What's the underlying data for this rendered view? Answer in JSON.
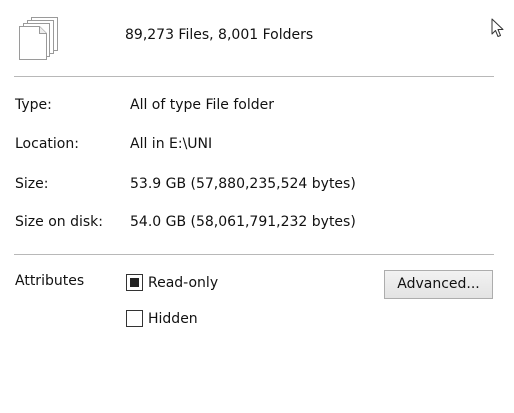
{
  "header": {
    "icon": "stacked-documents-icon",
    "summary": "89,273 Files, 8,001 Folders"
  },
  "properties": [
    {
      "label": "Type:",
      "value": "All of type File folder"
    },
    {
      "label": "Location:",
      "value": "All in E:\\UNI"
    },
    {
      "label": "Size:",
      "value": "53.9 GB (57,880,235,524 bytes)"
    },
    {
      "label": "Size on disk:",
      "value": "54.0 GB (58,061,791,232 bytes)"
    }
  ],
  "attributes": {
    "label": "Attributes",
    "read_only": {
      "label": "Read-only",
      "state": "indeterminate"
    },
    "hidden": {
      "label": "Hidden",
      "state": "unchecked"
    },
    "advanced_button": "Advanced..."
  }
}
